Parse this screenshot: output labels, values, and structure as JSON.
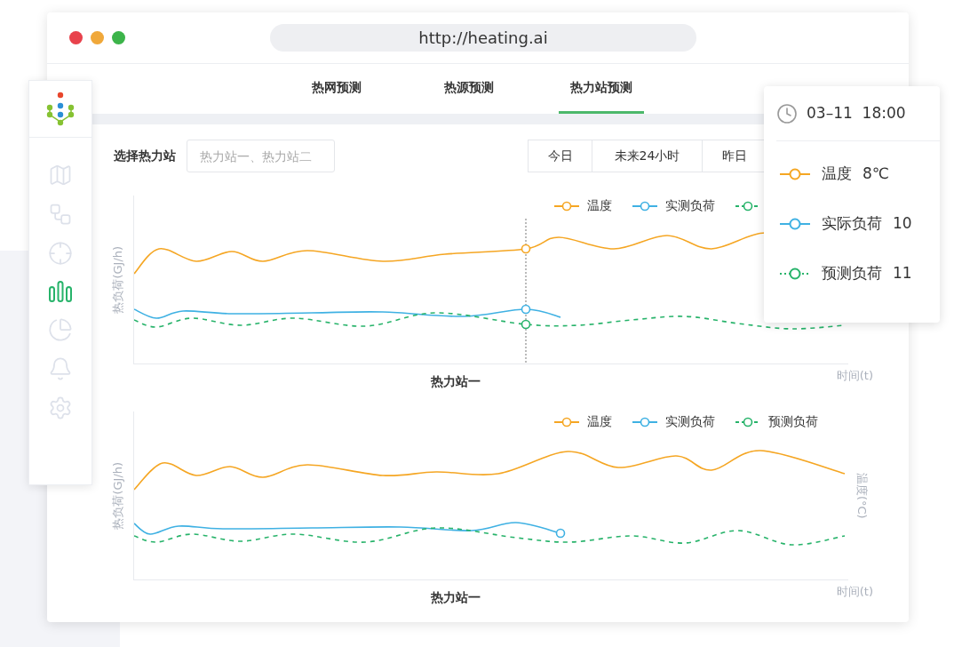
{
  "browser": {
    "url": "http://heating.ai"
  },
  "tabs": [
    {
      "label": "热网预测",
      "selected": false
    },
    {
      "label": "热源预测",
      "selected": false
    },
    {
      "label": "热力站预测",
      "selected": true
    }
  ],
  "sidebar": {
    "items": [
      {
        "kind": "map",
        "selected": false
      },
      {
        "kind": "network",
        "selected": false
      },
      {
        "kind": "target",
        "selected": false
      },
      {
        "kind": "bars",
        "selected": true
      },
      {
        "kind": "pie",
        "selected": false
      },
      {
        "kind": "bell",
        "selected": false
      },
      {
        "kind": "gear",
        "selected": false
      }
    ]
  },
  "filter": {
    "label": "选择热力站",
    "placeholder": "热力站一、热力站二"
  },
  "range_buttons": [
    "今日",
    "未来24小时",
    "昨日"
  ],
  "charts": [
    {
      "title": "热力站一",
      "ylabel": "热负荷(GJ/h)",
      "xlabel": "时间(t)",
      "cursor": true,
      "legend": [
        {
          "label": "温度",
          "kind": "solid",
          "color": "#f5a623"
        },
        {
          "label": "实测负荷",
          "kind": "solid",
          "color": "#3fb1e3"
        },
        {
          "kind": "dashed",
          "color": "#27b36a"
        }
      ]
    },
    {
      "title": "热力站一",
      "ylabel": "热负荷(GJ/h)",
      "y2label": "温度(°C)",
      "xlabel": "时间(t)",
      "cursor": false,
      "legend": [
        {
          "label": "温度",
          "kind": "solid",
          "color": "#f5a623"
        },
        {
          "label": "实测负荷",
          "kind": "solid",
          "color": "#3fb1e3"
        },
        {
          "label": "预测负荷",
          "kind": "dashed",
          "color": "#27b36a"
        }
      ]
    }
  ],
  "tooltip": {
    "time": "03–11  18:00",
    "rows": [
      {
        "label": "温度",
        "value": "8℃",
        "kind": "solid",
        "color": "#f5a623"
      },
      {
        "label": "实际负荷",
        "value": "10",
        "kind": "solid",
        "color": "#3fb1e3"
      },
      {
        "label": "预测负荷",
        "value": "11",
        "kind": "dotted",
        "color": "#27b36a"
      }
    ]
  }
}
